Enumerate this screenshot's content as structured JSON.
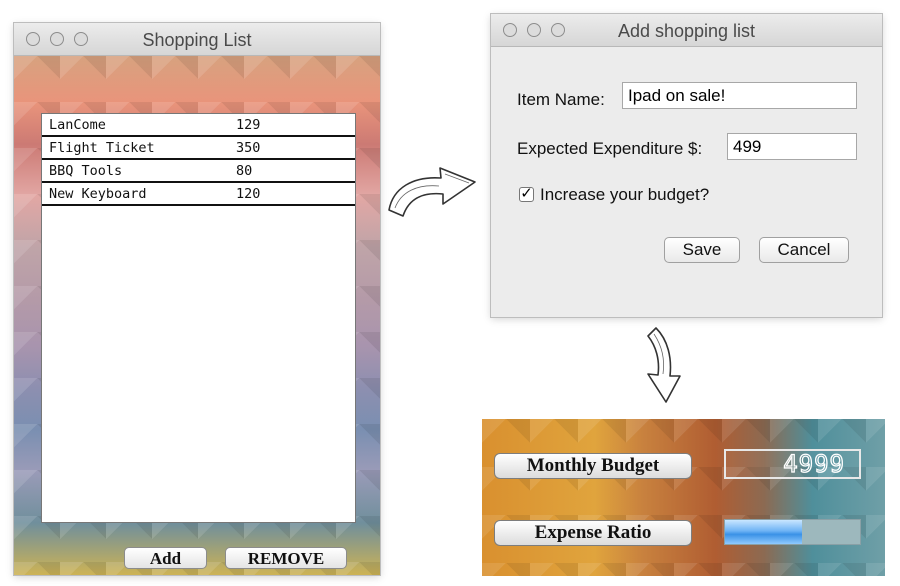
{
  "shopping_window": {
    "title": "Shopping List",
    "items": [
      {
        "name": "LanCome",
        "price": "129"
      },
      {
        "name": "Flight Ticket",
        "price": "350"
      },
      {
        "name": "BBQ Tools",
        "price": "80"
      },
      {
        "name": "New Keyboard",
        "price": "120"
      }
    ],
    "add_label": "Add",
    "remove_label": "REMOVE"
  },
  "add_dialog": {
    "title": "Add shopping list",
    "item_name_label": "Item Name:",
    "item_name_value": "Ipad on sale!",
    "expenditure_label": "Expected Expenditure $:",
    "expenditure_value": "499",
    "checkbox_label": "Increase your budget?",
    "checkbox_checked": true,
    "save_label": "Save",
    "cancel_label": "Cancel"
  },
  "budget_panel": {
    "monthly_budget_label": "Monthly Budget",
    "monthly_budget_value": "4999",
    "expense_ratio_label": "Expense Ratio",
    "expense_ratio_fraction": 0.57
  },
  "icons": [
    "window-close-icon",
    "window-minimize-icon",
    "window-zoom-icon",
    "checkmark-icon",
    "sketch-arrow-icon"
  ]
}
